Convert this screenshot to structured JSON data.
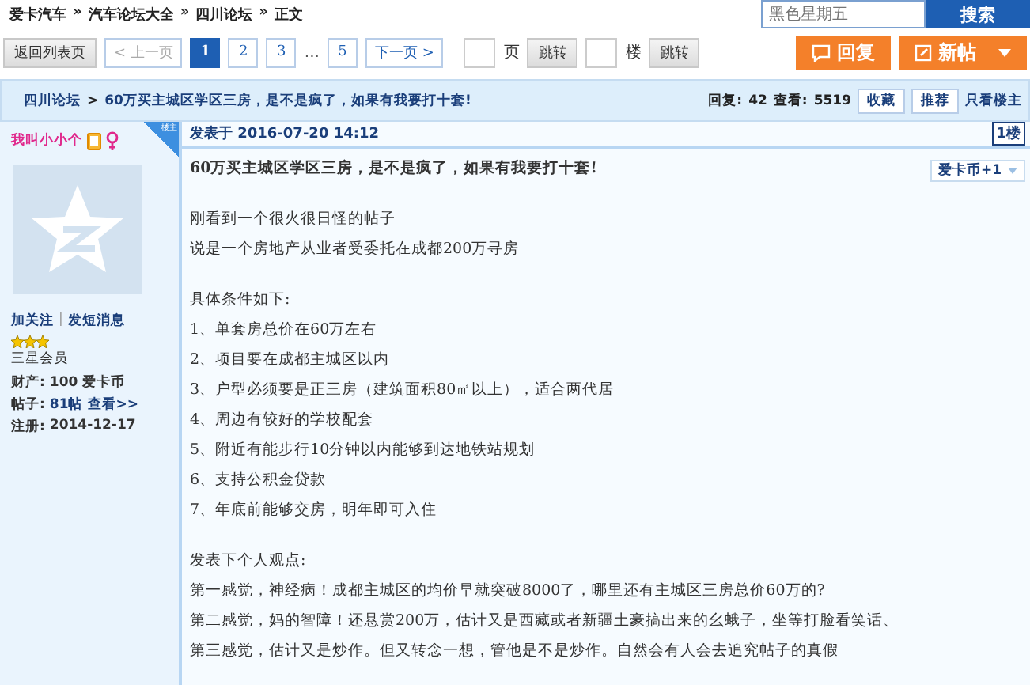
{
  "breadcrumb": [
    {
      "label": "爱卡汽车"
    },
    {
      "separator": "»",
      "label": "汽车论坛大全"
    },
    {
      "separator": "»",
      "label": "四川论坛"
    },
    {
      "separator": "»",
      "label": "正文"
    }
  ],
  "search": {
    "placeholder": "黑色星期五",
    "button": "搜索"
  },
  "pager": {
    "back": "返回列表页",
    "prev": {
      "label": "< 上一页",
      "disabled": true
    },
    "pages": [
      {
        "label": "1",
        "selected": true
      },
      {
        "label": "2",
        "selected": false
      },
      {
        "label": "3",
        "selected": false
      }
    ],
    "ellipsis": "...",
    "last_pages": [
      {
        "label": "5",
        "selected": false
      }
    ],
    "next": {
      "label": "下一页 >",
      "disabled": false
    },
    "page_unit": "页",
    "jump1": "跳转",
    "floor_unit": "楼",
    "jump2": "跳转"
  },
  "actions": {
    "reply": "回复",
    "new_post": "新帖"
  },
  "thread": {
    "forum": "四川论坛",
    "separator": ">",
    "title": "60万买主城区学区三房，是不是疯了，如果有我要打十套!",
    "replies_label": "回复:",
    "replies": "42",
    "views_label": "查看:",
    "views": "5519",
    "favorite": "收藏",
    "recommend": "推荐",
    "only_op": "只看楼主"
  },
  "author": {
    "name": "我叫小小个",
    "badge": "楼主",
    "follow": "加关注",
    "separator": "|",
    "message": "发短消息",
    "stars": 3,
    "rank": "三星会员",
    "wealth_label": "财产:",
    "wealth": "100 爱卡币",
    "posts_label": "帖子:",
    "posts": "81帖",
    "posts_link": "查看>>",
    "joined_label": "注册:",
    "joined": "2014-12-17"
  },
  "post": {
    "posted": "发表于 2016-07-20 14:12",
    "floor": "1楼",
    "coin_button": "爱卡币+1",
    "paragraphs": [
      [
        "60万买主城区学区三房，是不是疯了，如果有我要打十套!"
      ],
      [
        "刚看到一个很火很日怪的帖子",
        "说是一个房地产从业者受委托在成都200万寻房"
      ],
      [
        "具体条件如下:",
        "1、单套房总价在60万左右",
        "2、项目要在成都主城区以内",
        "3、户型必须要是正三房（建筑面积80㎡以上），适合两代居",
        "4、周边有较好的学校配套",
        "5、附近有能步行10分钟以内能够到达地铁站规划",
        "6、支持公积金贷款",
        "7、年底前能够交房，明年即可入住"
      ],
      [
        "发表下个人观点:",
        "第一感觉，神经病！成都主城区的均价早就突破8000了，哪里还有主城区三房总价60万的?",
        "第二感觉，妈的智障！还悬赏200万，估计又是西藏或者新疆土豪搞出来的幺蛾子，坐等打脸看笑话、",
        "第三感觉，估计又是炒作。但又转念一想，管他是不是炒作。自然会有人会去追究帖子的真假"
      ]
    ]
  }
}
